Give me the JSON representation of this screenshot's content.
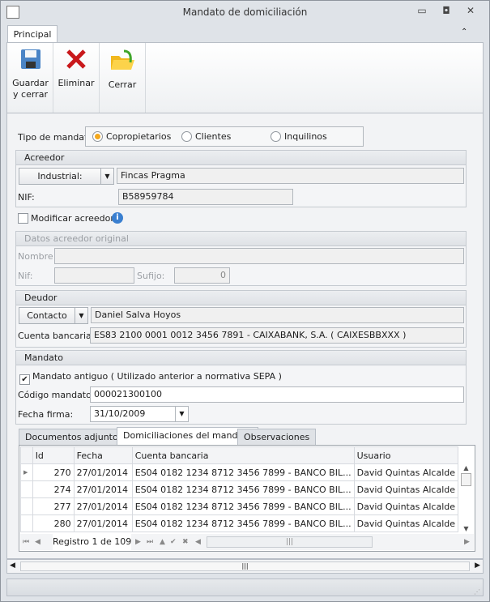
{
  "window": {
    "title": "Mandato de domiciliación"
  },
  "ribbon": {
    "tab": "Principal",
    "buttons": [
      {
        "label": "Guardar\ny cerrar",
        "icon": "save-icon"
      },
      {
        "label": "Eliminar",
        "icon": "delete-icon"
      },
      {
        "label": "Cerrar",
        "icon": "open-folder-icon"
      }
    ]
  },
  "tipo": {
    "label": "Tipo de mandato:",
    "options": [
      "Copropietarios",
      "Clientes",
      "Inquilinos"
    ],
    "selected": "Copropietarios"
  },
  "acreedor": {
    "title": "Acreedor",
    "combo": "Industrial:",
    "name": "Fincas Pragma",
    "nif_label": "NIF:",
    "nif": "B58959784"
  },
  "modificar": {
    "label": "Modificar acreedor",
    "checked": false
  },
  "original": {
    "title": "Datos acreedor original",
    "nombre_label": "Nombre:",
    "nombre": "",
    "nif_label": "Nif:",
    "nif": "",
    "sufijo_label": "Sufijo:",
    "sufijo": "0"
  },
  "deudor": {
    "title": "Deudor",
    "combo": "Contacto",
    "name": "Daniel Salva Hoyos",
    "cuenta_label": "Cuenta bancaria:",
    "cuenta": "ES83 2100 0001 0012 3456 7891 - CAIXABANK, S.A. ( CAIXESBBXXX )"
  },
  "mandato": {
    "title": "Mandato",
    "antiguo_label": "Mandato antiguo ( Utilizado anterior a normativa SEPA )",
    "antiguo": true,
    "codigo_label": "Código mandato:",
    "codigo": "000021300100",
    "fecha_label": "Fecha firma:",
    "fecha": "31/10/2009"
  },
  "tabs": [
    "Documentos adjuntos",
    "Domiciliaciones del mandato",
    "Observaciones"
  ],
  "grid": {
    "columns": [
      "Id",
      "Fecha",
      "Cuenta bancaria",
      "Usuario"
    ],
    "rows": [
      [
        "270",
        "27/01/2014",
        "ES04 0182 1234 8712 3456 7899 - BANCO BIL...",
        "David Quintas Alcalde"
      ],
      [
        "274",
        "27/01/2014",
        "ES04 0182 1234 8712 3456 7899 - BANCO BIL...",
        "David Quintas Alcalde"
      ],
      [
        "277",
        "27/01/2014",
        "ES04 0182 1234 8712 3456 7899 - BANCO BIL...",
        "David Quintas Alcalde"
      ],
      [
        "280",
        "27/01/2014",
        "ES04 0182 1234 8712 3456 7899 - BANCO BIL...",
        "David Quintas Alcalde"
      ]
    ],
    "navigator": "Registro 1 de 109"
  }
}
